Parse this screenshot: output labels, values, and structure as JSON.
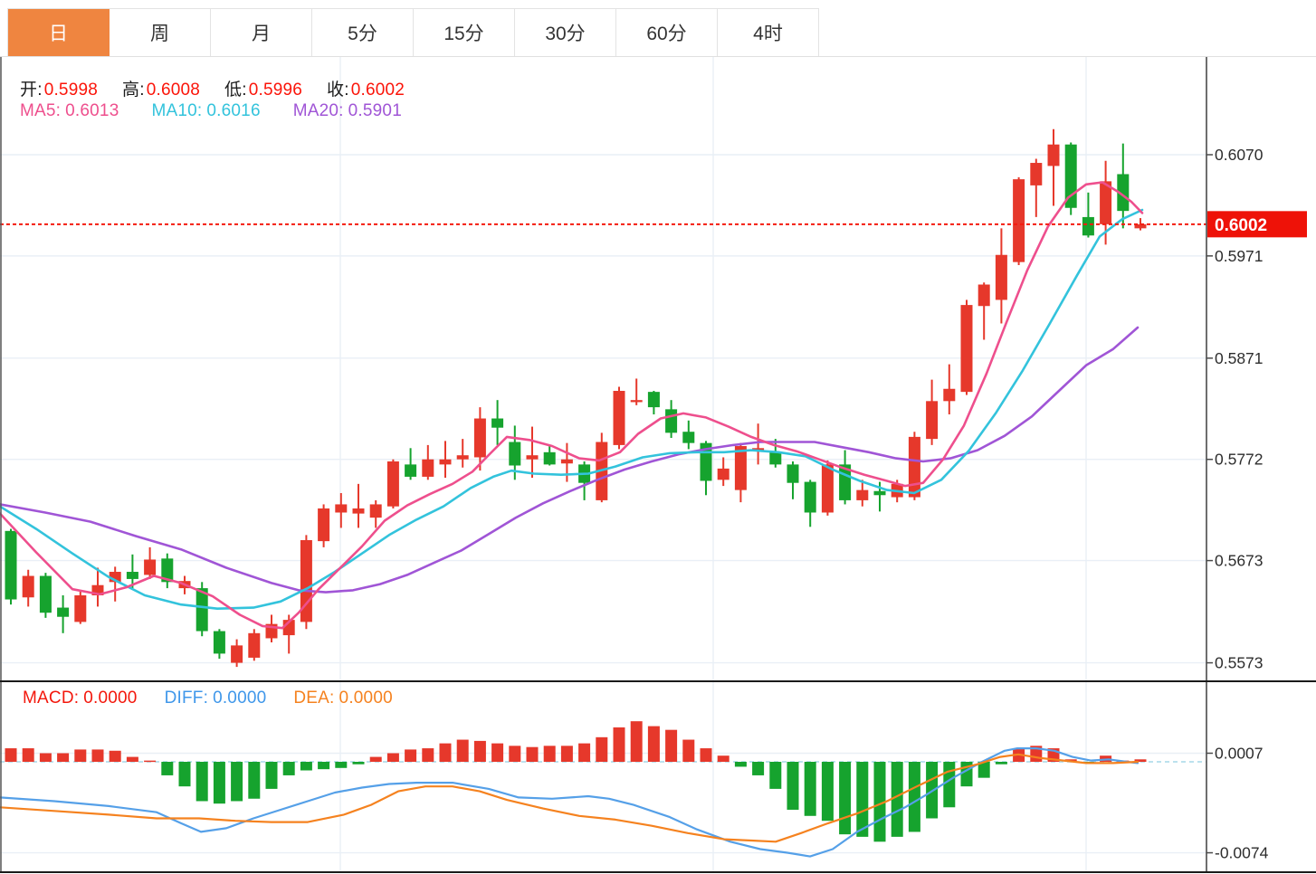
{
  "toolbar": {
    "tabs": [
      {
        "name": "day",
        "label": "日",
        "active": true
      },
      {
        "name": "week",
        "label": "周",
        "active": false
      },
      {
        "name": "month",
        "label": "月",
        "active": false
      },
      {
        "name": "5min",
        "label": "5分",
        "active": false
      },
      {
        "name": "15min",
        "label": "15分",
        "active": false
      },
      {
        "name": "30min",
        "label": "30分",
        "active": false
      },
      {
        "name": "60min",
        "label": "60分",
        "active": false
      },
      {
        "name": "4hour",
        "label": "4时",
        "active": false
      }
    ]
  },
  "legend": {
    "label_color": "#1c1c1c",
    "value_color": "#fb1409",
    "ohlc": [
      {
        "name": "open",
        "label": "开:",
        "value": "0.5998"
      },
      {
        "name": "high",
        "label": "高:",
        "value": "0.6008"
      },
      {
        "name": "low",
        "label": "低:",
        "value": "0.5996"
      },
      {
        "name": "close",
        "label": "收:",
        "value": "0.6002"
      }
    ],
    "ma": [
      {
        "name": "ma5",
        "label": "MA5:",
        "value": "0.6013",
        "color": "#ee4f8d"
      },
      {
        "name": "ma10",
        "label": "MA10:",
        "value": "0.6016",
        "color": "#33c3dc"
      },
      {
        "name": "ma20",
        "label": "MA20:",
        "value": "0.5901",
        "color": "#a055d6"
      }
    ],
    "macd": [
      {
        "name": "macd",
        "label": "MACD:",
        "value": "0.0000",
        "color": "#f3170c"
      },
      {
        "name": "diff",
        "label": "DIFF:",
        "value": "0.0000",
        "color": "#3f97ea"
      },
      {
        "name": "dea",
        "label": "DEA:",
        "value": "0.0000",
        "color": "#f5821f"
      }
    ]
  },
  "price_marker": {
    "value": "0.6002",
    "price": 0.6002,
    "bg": "#ee1208",
    "text_color": "#ffffff"
  },
  "chart_data": {
    "type": "candlestick",
    "style": {
      "up_color": "#e6382b",
      "down_color": "#16a32e",
      "ma5_color": "#ee4f8d",
      "ma10_color": "#33c3dc",
      "ma20_color": "#a055d6",
      "diff_color": "#55a0e8",
      "dea_color": "#f5821f",
      "grid_color": "#e9eff6",
      "axis_color": "#4a4a4a",
      "dark_line": "#1a1a1a",
      "tick_label_color": "#2d2d2d",
      "dotted_line_color": "#f41b0f",
      "zero_dash_color": "#a6d9e8"
    },
    "price_ticks": [
      {
        "p": 0.607,
        "label": "0.6070"
      },
      {
        "p": 0.5971,
        "label": "0.5971"
      },
      {
        "p": 0.5871,
        "label": "0.5871"
      },
      {
        "p": 0.5772,
        "label": "0.5772"
      },
      {
        "p": 0.5673,
        "label": "0.5673"
      },
      {
        "p": 0.5573,
        "label": "0.5573"
      }
    ],
    "macd_ticks": [
      {
        "v": 0.0007,
        "label": "0.0007"
      },
      {
        "v": -0.0074,
        "label": "-0.0074"
      }
    ],
    "v_gridlines": [
      376,
      788,
      1200
    ],
    "dotted_price": 0.6002,
    "candles": [
      [
        0.5702,
        0.5704,
        0.563,
        0.5635
      ],
      [
        0.5637,
        0.5664,
        0.5628,
        0.5658
      ],
      [
        0.5658,
        0.5661,
        0.5617,
        0.5622
      ],
      [
        0.5627,
        0.5639,
        0.5602,
        0.5618
      ],
      [
        0.5613,
        0.5643,
        0.5611,
        0.5639
      ],
      [
        0.5639,
        0.5666,
        0.5628,
        0.5649
      ],
      [
        0.5652,
        0.5667,
        0.5633,
        0.5662
      ],
      [
        0.5662,
        0.5679,
        0.5646,
        0.5655
      ],
      [
        0.5659,
        0.5686,
        0.5655,
        0.5674
      ],
      [
        0.5675,
        0.568,
        0.5646,
        0.5652
      ],
      [
        0.5646,
        0.5658,
        0.564,
        0.5653
      ],
      [
        0.5646,
        0.5652,
        0.5599,
        0.5604
      ],
      [
        0.5604,
        0.5606,
        0.5577,
        0.5582
      ],
      [
        0.5573,
        0.5596,
        0.5569,
        0.559
      ],
      [
        0.5578,
        0.5606,
        0.5575,
        0.5602
      ],
      [
        0.5597,
        0.562,
        0.5593,
        0.5611
      ],
      [
        0.56,
        0.562,
        0.5582,
        0.5615
      ],
      [
        0.5613,
        0.5698,
        0.5606,
        0.5693
      ],
      [
        0.5692,
        0.5728,
        0.5686,
        0.5724
      ],
      [
        0.572,
        0.5739,
        0.5705,
        0.5728
      ],
      [
        0.5719,
        0.5748,
        0.5705,
        0.5724
      ],
      [
        0.5715,
        0.5732,
        0.5705,
        0.5728
      ],
      [
        0.5726,
        0.5772,
        0.5724,
        0.577
      ],
      [
        0.5767,
        0.5783,
        0.5752,
        0.5755
      ],
      [
        0.5755,
        0.5786,
        0.5752,
        0.5772
      ],
      [
        0.5767,
        0.579,
        0.5754,
        0.5772
      ],
      [
        0.5772,
        0.5792,
        0.5764,
        0.5776
      ],
      [
        0.5774,
        0.5823,
        0.5761,
        0.5812
      ],
      [
        0.5812,
        0.583,
        0.5786,
        0.5803
      ],
      [
        0.5789,
        0.5805,
        0.5752,
        0.5766
      ],
      [
        0.5772,
        0.5804,
        0.5754,
        0.5776
      ],
      [
        0.5779,
        0.5785,
        0.5766,
        0.5767
      ],
      [
        0.5768,
        0.5788,
        0.575,
        0.5772
      ],
      [
        0.5767,
        0.577,
        0.5732,
        0.5749
      ],
      [
        0.5732,
        0.5798,
        0.573,
        0.5789
      ],
      [
        0.5786,
        0.5843,
        0.5782,
        0.5839
      ],
      [
        0.5828,
        0.5851,
        0.5825,
        0.583
      ],
      [
        0.5838,
        0.5839,
        0.5816,
        0.5823
      ],
      [
        0.5821,
        0.583,
        0.5793,
        0.5798
      ],
      [
        0.5799,
        0.581,
        0.5782,
        0.5788
      ],
      [
        0.5788,
        0.579,
        0.5737,
        0.5751
      ],
      [
        0.5752,
        0.5774,
        0.5746,
        0.5763
      ],
      [
        0.5742,
        0.5788,
        0.573,
        0.5785
      ],
      [
        0.5781,
        0.5807,
        0.5767,
        0.5783
      ],
      [
        0.5779,
        0.5792,
        0.5764,
        0.5767
      ],
      [
        0.5767,
        0.577,
        0.5733,
        0.5749
      ],
      [
        0.575,
        0.5752,
        0.5706,
        0.572
      ],
      [
        0.572,
        0.5771,
        0.5717,
        0.5767
      ],
      [
        0.5767,
        0.5781,
        0.5728,
        0.5732
      ],
      [
        0.5732,
        0.5752,
        0.5726,
        0.5742
      ],
      [
        0.5741,
        0.575,
        0.5721,
        0.5737
      ],
      [
        0.5735,
        0.5752,
        0.573,
        0.5748
      ],
      [
        0.5735,
        0.5799,
        0.5732,
        0.5794
      ],
      [
        0.5792,
        0.585,
        0.5786,
        0.5829
      ],
      [
        0.5829,
        0.5865,
        0.5816,
        0.5841
      ],
      [
        0.5838,
        0.5928,
        0.5835,
        0.5923
      ],
      [
        0.5922,
        0.5945,
        0.5889,
        0.5943
      ],
      [
        0.5928,
        0.5998,
        0.5905,
        0.5972
      ],
      [
        0.5965,
        0.6048,
        0.5962,
        0.6046
      ],
      [
        0.604,
        0.6066,
        0.6009,
        0.6062
      ],
      [
        0.6059,
        0.6095,
        0.602,
        0.608
      ],
      [
        0.608,
        0.6082,
        0.6011,
        0.6018
      ],
      [
        0.6009,
        0.6033,
        0.5989,
        0.5991
      ],
      [
        0.6002,
        0.6064,
        0.5982,
        0.6044
      ],
      [
        0.6051,
        0.6081,
        0.5998,
        0.6015
      ],
      [
        0.5998,
        0.6008,
        0.5996,
        0.6002
      ]
    ],
    "macd_hist": [
      0.0011,
      0.0011,
      0.0007,
      0.0007,
      0.001,
      0.001,
      0.0009,
      0.0004,
      0.0001,
      -0.0011,
      -0.002,
      -0.0032,
      -0.0034,
      -0.0032,
      -0.003,
      -0.0022,
      -0.0011,
      -0.0007,
      -0.0006,
      -0.0005,
      -0.0002,
      0.0004,
      0.0007,
      0.001,
      0.0011,
      0.0015,
      0.0018,
      0.0017,
      0.0015,
      0.0013,
      0.0012,
      0.0013,
      0.0013,
      0.0015,
      0.002,
      0.0028,
      0.0033,
      0.0029,
      0.0026,
      0.0018,
      0.0011,
      0.0005,
      -0.0004,
      -0.0011,
      -0.0022,
      -0.0039,
      -0.0044,
      -0.0048,
      -0.0059,
      -0.0061,
      -0.0065,
      -0.0061,
      -0.0057,
      -0.0046,
      -0.0037,
      -0.002,
      -0.0013,
      -0.0002,
      0.0011,
      0.0013,
      0.0011,
      0.0002,
      -0.0001,
      0.0005,
      0.0001,
      0.0002
    ],
    "ma5": [
      [
        0,
        0.5719
      ],
      [
        40,
        0.5681
      ],
      [
        80,
        0.5645
      ],
      [
        110,
        0.564
      ],
      [
        140,
        0.5647
      ],
      [
        170,
        0.5658
      ],
      [
        200,
        0.5651
      ],
      [
        235,
        0.5638
      ],
      [
        265,
        0.562
      ],
      [
        290,
        0.5609
      ],
      [
        312,
        0.5607
      ],
      [
        330,
        0.5622
      ],
      [
        352,
        0.5645
      ],
      [
        375,
        0.5665
      ],
      [
        400,
        0.5687
      ],
      [
        425,
        0.5712
      ],
      [
        450,
        0.5727
      ],
      [
        475,
        0.5738
      ],
      [
        500,
        0.5748
      ],
      [
        522,
        0.576
      ],
      [
        542,
        0.5778
      ],
      [
        560,
        0.5794
      ],
      [
        585,
        0.5791
      ],
      [
        610,
        0.5785
      ],
      [
        640,
        0.5773
      ],
      [
        662,
        0.5771
      ],
      [
        685,
        0.5779
      ],
      [
        705,
        0.5797
      ],
      [
        730,
        0.5812
      ],
      [
        755,
        0.5817
      ],
      [
        780,
        0.5813
      ],
      [
        805,
        0.5804
      ],
      [
        830,
        0.5794
      ],
      [
        855,
        0.5786
      ],
      [
        880,
        0.578
      ],
      [
        905,
        0.5772
      ],
      [
        930,
        0.5764
      ],
      [
        955,
        0.5757
      ],
      [
        980,
        0.5751
      ],
      [
        1000,
        0.5746
      ],
      [
        1020,
        0.5749
      ],
      [
        1042,
        0.5772
      ],
      [
        1065,
        0.5805
      ],
      [
        1090,
        0.5856
      ],
      [
        1112,
        0.5906
      ],
      [
        1135,
        0.5957
      ],
      [
        1158,
        0.6
      ],
      [
        1180,
        0.6028
      ],
      [
        1200,
        0.6041
      ],
      [
        1218,
        0.6043
      ],
      [
        1235,
        0.6034
      ],
      [
        1250,
        0.6024
      ],
      [
        1262,
        0.6013
      ]
    ],
    "ma10": [
      [
        0,
        0.5726
      ],
      [
        40,
        0.5704
      ],
      [
        80,
        0.568
      ],
      [
        120,
        0.5657
      ],
      [
        160,
        0.5639
      ],
      [
        200,
        0.563
      ],
      [
        240,
        0.5626
      ],
      [
        280,
        0.5627
      ],
      [
        310,
        0.5633
      ],
      [
        340,
        0.5646
      ],
      [
        370,
        0.5662
      ],
      [
        400,
        0.568
      ],
      [
        430,
        0.5698
      ],
      [
        460,
        0.5713
      ],
      [
        490,
        0.5726
      ],
      [
        520,
        0.5744
      ],
      [
        545,
        0.5755
      ],
      [
        565,
        0.5761
      ],
      [
        590,
        0.5758
      ],
      [
        620,
        0.5757
      ],
      [
        650,
        0.5758
      ],
      [
        680,
        0.5765
      ],
      [
        710,
        0.5774
      ],
      [
        740,
        0.5778
      ],
      [
        770,
        0.5779
      ],
      [
        800,
        0.5779
      ],
      [
        830,
        0.5781
      ],
      [
        860,
        0.5779
      ],
      [
        890,
        0.5775
      ],
      [
        920,
        0.5762
      ],
      [
        950,
        0.5751
      ],
      [
        980,
        0.5742
      ],
      [
        1010,
        0.5739
      ],
      [
        1040,
        0.5752
      ],
      [
        1070,
        0.578
      ],
      [
        1100,
        0.5817
      ],
      [
        1130,
        0.5859
      ],
      [
        1160,
        0.5905
      ],
      [
        1190,
        0.5952
      ],
      [
        1215,
        0.599
      ],
      [
        1240,
        0.6007
      ],
      [
        1262,
        0.6016
      ]
    ],
    "ma20": [
      [
        0,
        0.5728
      ],
      [
        50,
        0.572
      ],
      [
        100,
        0.5711
      ],
      [
        150,
        0.5697
      ],
      [
        200,
        0.5684
      ],
      [
        250,
        0.5666
      ],
      [
        300,
        0.5651
      ],
      [
        330,
        0.5644
      ],
      [
        360,
        0.5642
      ],
      [
        390,
        0.5644
      ],
      [
        420,
        0.565
      ],
      [
        450,
        0.5659
      ],
      [
        480,
        0.5671
      ],
      [
        510,
        0.5683
      ],
      [
        540,
        0.5699
      ],
      [
        570,
        0.5715
      ],
      [
        600,
        0.5729
      ],
      [
        630,
        0.5741
      ],
      [
        660,
        0.5752
      ],
      [
        690,
        0.5762
      ],
      [
        720,
        0.577
      ],
      [
        750,
        0.5777
      ],
      [
        780,
        0.5782
      ],
      [
        810,
        0.5786
      ],
      [
        840,
        0.5789
      ],
      [
        870,
        0.5789
      ],
      [
        900,
        0.5789
      ],
      [
        930,
        0.5784
      ],
      [
        960,
        0.5779
      ],
      [
        990,
        0.5773
      ],
      [
        1020,
        0.577
      ],
      [
        1050,
        0.5773
      ],
      [
        1080,
        0.5781
      ],
      [
        1110,
        0.5795
      ],
      [
        1140,
        0.5814
      ],
      [
        1170,
        0.5839
      ],
      [
        1200,
        0.5864
      ],
      [
        1230,
        0.588
      ],
      [
        1257,
        0.5901
      ]
    ],
    "diff": [
      [
        0,
        -0.0029
      ],
      [
        60,
        -0.0032
      ],
      [
        120,
        -0.0036
      ],
      [
        173,
        -0.0041
      ],
      [
        200,
        -0.005
      ],
      [
        222,
        -0.0057
      ],
      [
        250,
        -0.0054
      ],
      [
        280,
        -0.0046
      ],
      [
        310,
        -0.0039
      ],
      [
        340,
        -0.0032
      ],
      [
        370,
        -0.0025
      ],
      [
        400,
        -0.0021
      ],
      [
        430,
        -0.0018
      ],
      [
        460,
        -0.0017
      ],
      [
        500,
        -0.0017
      ],
      [
        540,
        -0.0022
      ],
      [
        573,
        -0.0029
      ],
      [
        610,
        -0.003
      ],
      [
        650,
        -0.0028
      ],
      [
        673,
        -0.003
      ],
      [
        700,
        -0.0035
      ],
      [
        740,
        -0.0045
      ],
      [
        770,
        -0.0055
      ],
      [
        807,
        -0.0065
      ],
      [
        840,
        -0.0071
      ],
      [
        870,
        -0.0074
      ],
      [
        895,
        -0.0077
      ],
      [
        920,
        -0.0071
      ],
      [
        947,
        -0.0057
      ],
      [
        975,
        -0.0046
      ],
      [
        1000,
        -0.0037
      ],
      [
        1023,
        -0.0027
      ],
      [
        1053,
        -0.0013
      ],
      [
        1085,
        0.0
      ],
      [
        1110,
        0.0009
      ],
      [
        1124,
        0.0011
      ],
      [
        1145,
        0.0011
      ],
      [
        1165,
        0.0009
      ],
      [
        1185,
        0.0004
      ],
      [
        1205,
        0.0001
      ],
      [
        1225,
        0.0002
      ],
      [
        1245,
        0.0
      ],
      [
        1257,
        -0.0001
      ]
    ],
    "dea": [
      [
        0,
        -0.0037
      ],
      [
        60,
        -0.004
      ],
      [
        120,
        -0.0043
      ],
      [
        173,
        -0.0046
      ],
      [
        220,
        -0.0046
      ],
      [
        260,
        -0.0048
      ],
      [
        300,
        -0.0049
      ],
      [
        340,
        -0.0049
      ],
      [
        380,
        -0.0043
      ],
      [
        410,
        -0.0035
      ],
      [
        440,
        -0.0024
      ],
      [
        470,
        -0.002
      ],
      [
        500,
        -0.002
      ],
      [
        530,
        -0.0024
      ],
      [
        560,
        -0.0031
      ],
      [
        600,
        -0.0038
      ],
      [
        640,
        -0.0044
      ],
      [
        680,
        -0.0047
      ],
      [
        720,
        -0.0052
      ],
      [
        760,
        -0.0058
      ],
      [
        800,
        -0.0063
      ],
      [
        830,
        -0.0064
      ],
      [
        857,
        -0.0065
      ],
      [
        885,
        -0.0058
      ],
      [
        915,
        -0.005
      ],
      [
        947,
        -0.0042
      ],
      [
        980,
        -0.0032
      ],
      [
        1013,
        -0.002
      ],
      [
        1047,
        -0.0008
      ],
      [
        1080,
        -0.0002
      ],
      [
        1105,
        0.0004
      ],
      [
        1125,
        0.0006
      ],
      [
        1150,
        0.0003
      ],
      [
        1175,
        0.0001
      ],
      [
        1200,
        -0.0001
      ],
      [
        1230,
        -0.0001
      ],
      [
        1257,
        0.0
      ]
    ]
  }
}
